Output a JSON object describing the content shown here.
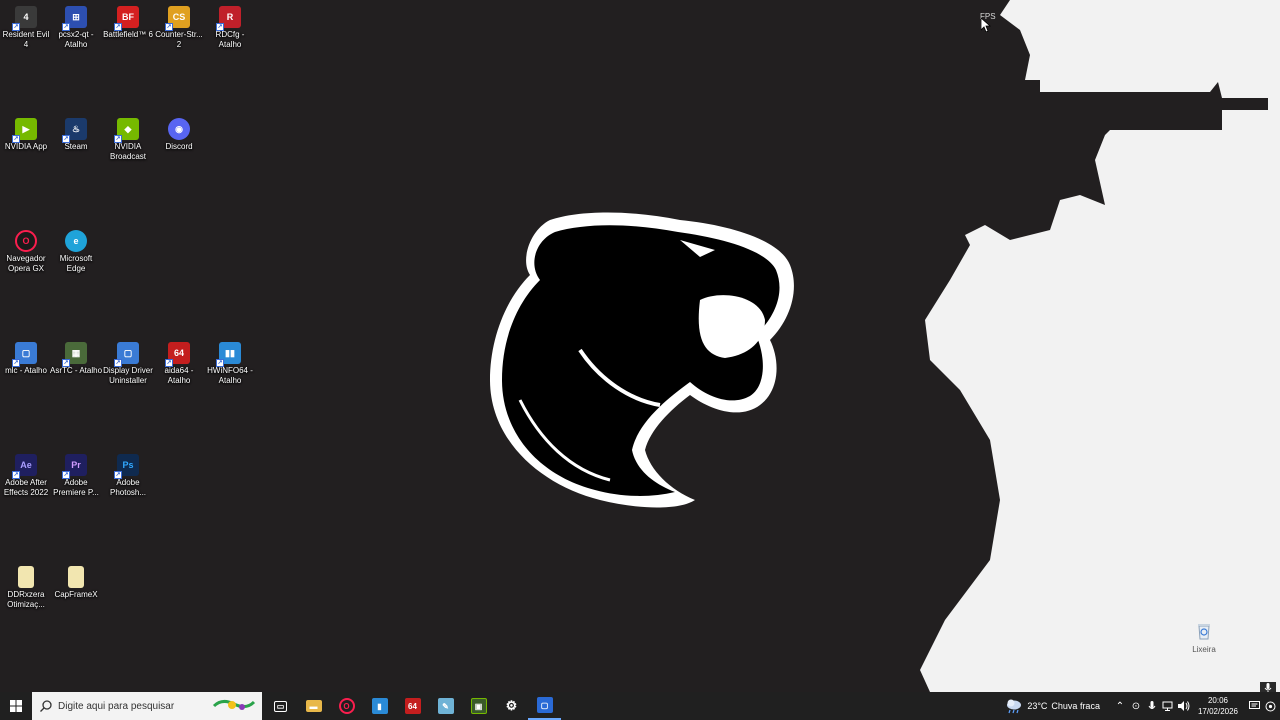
{
  "desktop": {
    "icons": [
      {
        "label": "Resident Evil 4",
        "icon": "resident-evil-icon",
        "color": "#3a3a3a"
      },
      {
        "label": "pcsx2-qt - Atalho",
        "icon": "pcsx2-icon",
        "color": "#2d4fb0"
      },
      {
        "label": "Battlefield™ 6",
        "icon": "battlefield-icon",
        "color": "#d42020"
      },
      {
        "label": "Counter-Str... 2",
        "icon": "counter-strike-icon",
        "color": "#e0a020"
      },
      {
        "label": "RDCfg - Atalho",
        "icon": "rdcfg-icon",
        "color": "#c0202a"
      },
      {
        "label": "NVIDIA App",
        "icon": "nvidia-icon",
        "color": "#76b900"
      },
      {
        "label": "Steam",
        "icon": "steam-icon",
        "color": "#1b3a6b"
      },
      {
        "label": "NVIDIA Broadcast",
        "icon": "nvidia-broadcast-icon",
        "color": "#76b900"
      },
      {
        "label": "Discord",
        "icon": "discord-icon",
        "color": "#5865f2"
      },
      {
        "label": "Navegador Opera GX",
        "icon": "opera-gx-icon",
        "color": "#fa1e4e"
      },
      {
        "label": "Microsoft Edge",
        "icon": "edge-icon",
        "color": "#1fa3d9"
      },
      {
        "label": "mlc - Atalho",
        "icon": "mlc-icon",
        "color": "#3a7bd5"
      },
      {
        "label": "AsrTC - Atalho",
        "icon": "asrtc-icon",
        "color": "#4a6a3a"
      },
      {
        "label": "Display Driver Uninstaller",
        "icon": "ddu-icon",
        "color": "#3a7bd5"
      },
      {
        "label": "aida64 - Atalho",
        "icon": "aida64-icon",
        "color": "#c41e1e"
      },
      {
        "label": "HWiNFO64 - Atalho",
        "icon": "hwinfo-icon",
        "color": "#2a8ad6"
      },
      {
        "label": "Adobe After Effects 2022",
        "icon": "after-effects-icon",
        "color": "#1f1f5f"
      },
      {
        "label": "Adobe Premiere P...",
        "icon": "premiere-icon",
        "color": "#1f1f5f"
      },
      {
        "label": "Adobe Photosh...",
        "icon": "photoshop-icon",
        "color": "#0f2a4f"
      },
      {
        "label": "DDRxzera Otimizaç...",
        "icon": "file-icon",
        "color": "#f2e6b0"
      },
      {
        "label": "CapFrameX",
        "icon": "file-icon",
        "color": "#f2e6b0"
      }
    ],
    "icon_glyphs": [
      "4",
      "⊞",
      "BF",
      "CS",
      "R",
      "▶",
      "♨",
      "◆",
      "◉",
      "O",
      "e",
      "▢",
      "▦",
      "▢",
      "64",
      "▮▮",
      "Ae",
      "Pr",
      "Ps",
      "",
      ""
    ],
    "recycle_bin_label": "Lixeira",
    "overlay": {
      "fps_label": "FPS"
    }
  },
  "taskbar": {
    "search_placeholder": "Digite aqui para pesquisar",
    "pinned": [
      {
        "name": "task-view-button",
        "icon": "task-view-icon",
        "glyph": "▭",
        "color": "#202020"
      },
      {
        "name": "file-explorer-button",
        "icon": "folder-icon",
        "glyph": "▬",
        "color": "#e8b84a"
      },
      {
        "name": "opera-gx-button",
        "icon": "opera-gx-icon",
        "glyph": "O",
        "color": "#202020"
      },
      {
        "name": "hwinfo-button",
        "icon": "hwinfo-icon",
        "glyph": "▮",
        "color": "#2a8ad6"
      },
      {
        "name": "aida64-button",
        "icon": "aida64-icon",
        "glyph": "64",
        "color": "#c41e1e"
      },
      {
        "name": "notepad-button",
        "icon": "notepad-icon",
        "glyph": "✎",
        "color": "#6fb3d6"
      },
      {
        "name": "nvidia-button",
        "icon": "nvidia-icon",
        "glyph": "▣",
        "color": "#3a5a2a"
      },
      {
        "name": "settings-button",
        "icon": "gear-icon",
        "glyph": "⚙",
        "color": "#202020"
      },
      {
        "name": "ddu-button",
        "icon": "ddu-icon",
        "glyph": "▢",
        "color": "#2a6ad6"
      }
    ],
    "weather": {
      "temp": "23°C",
      "condition": "Chuva fraca"
    },
    "clock": {
      "time": "20:06",
      "date": "17/02/2026"
    }
  }
}
